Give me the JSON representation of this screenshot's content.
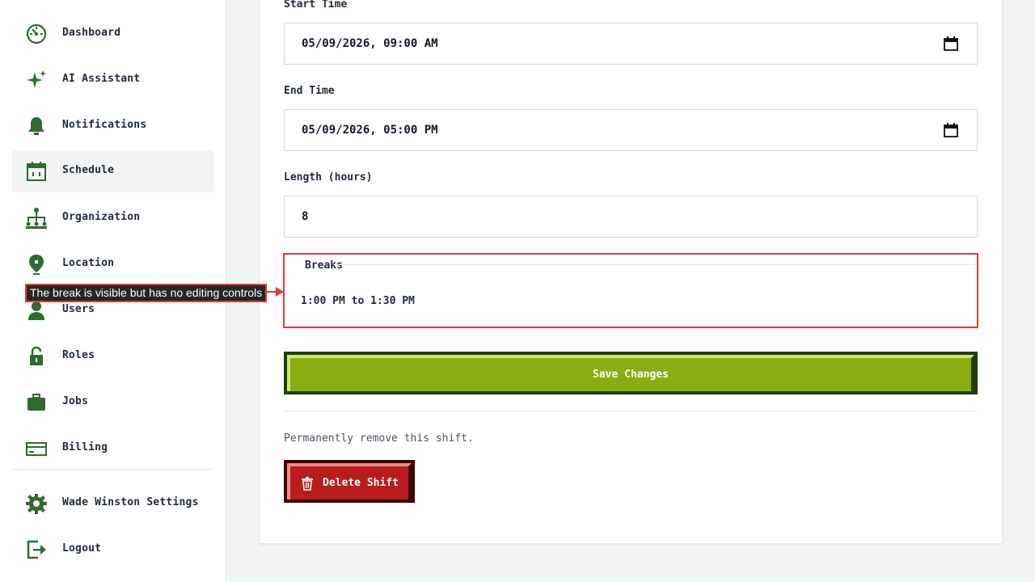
{
  "colors": {
    "icon_green": "#2e6b2f",
    "save_button": "#8aad12",
    "delete_button": "#b91c1c",
    "annotation_border": "#e23b3b"
  },
  "sidebar": {
    "items": [
      {
        "label": "Dashboard",
        "icon": "dashboard-gauge-icon",
        "active": false
      },
      {
        "label": "AI Assistant",
        "icon": "sparkle-icon",
        "active": false
      },
      {
        "label": "Notifications",
        "icon": "bell-icon",
        "active": false
      },
      {
        "label": "Schedule",
        "icon": "calendar-icon",
        "active": true
      },
      {
        "label": "Organization",
        "icon": "org-chart-icon",
        "active": false
      },
      {
        "label": "Location",
        "icon": "map-pin-icon",
        "active": false
      },
      {
        "label": "Users",
        "icon": "user-icon",
        "active": false
      },
      {
        "label": "Roles",
        "icon": "lock-icon",
        "active": false
      },
      {
        "label": "Jobs",
        "icon": "briefcase-icon",
        "active": false
      },
      {
        "label": "Billing",
        "icon": "credit-card-icon",
        "active": false
      }
    ],
    "footer_items": [
      {
        "label": "Wade Winston Settings",
        "icon": "gear-icon"
      },
      {
        "label": "Logout",
        "icon": "logout-icon"
      }
    ]
  },
  "form": {
    "start_time": {
      "label": "Start Time",
      "value": "05/09/2026, 09:00 AM"
    },
    "end_time": {
      "label": "End Time",
      "value": "05/09/2026, 05:00 PM"
    },
    "length": {
      "label": "Length (hours)",
      "value": "8"
    },
    "breaks": {
      "legend": "Breaks",
      "items": [
        "1:00 PM to 1:30 PM"
      ]
    },
    "save_label": "Save Changes",
    "danger_text": "Permanently remove this shift.",
    "delete_label": "Delete Shift"
  },
  "annotation": {
    "text": "The break is visible but has no editing controls"
  }
}
